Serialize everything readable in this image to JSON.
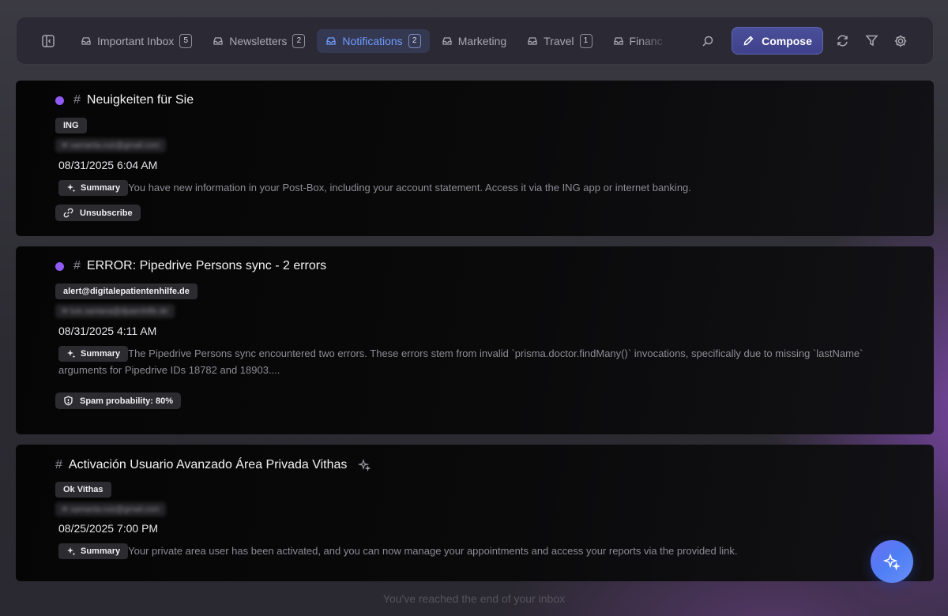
{
  "toolbar": {
    "tabs": [
      {
        "label": "Important Inbox",
        "count": "5"
      },
      {
        "label": "Newsletters",
        "count": "2"
      },
      {
        "label": "Notifications",
        "count": "2"
      },
      {
        "label": "Marketing",
        "count": ""
      },
      {
        "label": "Travel",
        "count": "1"
      },
      {
        "label": "Financ",
        "count": ""
      }
    ],
    "active_tab": "Notifications",
    "compose_label": "Compose",
    "accent_color": "#6f9dff"
  },
  "emails": [
    {
      "subject": "Neuigkeiten für Sie",
      "sender": "ING",
      "recipient": "samanta.ruiz@gmail.com",
      "date": "08/31/2025 6:04 AM",
      "summary_label": "Summary",
      "summary": "You have new information in your Post-Box, including your account statement. Access it via the ING app or internet banking.",
      "action": "Unsubscribe",
      "unread": true
    },
    {
      "subject": "ERROR: Pipedrive Persons sync - 2 errors",
      "sender": "alert@digitalepatientenhilfe.de",
      "recipient": "luis.santana@dpaenhilfe.de",
      "date": "08/31/2025 4:11 AM",
      "summary_label": "Summary",
      "summary": "The Pipedrive Persons sync encountered two errors. These errors stem from invalid `prisma.doctor.findMany()` invocations, specifically due to missing `lastName` arguments for Pipedrive IDs 18782 and 18903....",
      "action": "Spam probability: 80%",
      "unread": true
    },
    {
      "subject": "Activación Usuario Avanzado Área Privada Vithas",
      "sender": "Ok Vithas",
      "recipient": "samanta.ruiz@gmail.com",
      "date": "08/25/2025 7:00 PM",
      "summary_label": "Summary",
      "summary": "Your private area user has been activated, and you can now manage your appointments and access your reports via the provided link.",
      "unread": false
    }
  ],
  "footer": {
    "end_text": "You've reached the end of your inbox"
  },
  "colors": {
    "unread_dot": "#8f5bf2",
    "compose_bg": "#4a4f9a",
    "fab": "#5b7cf4"
  }
}
